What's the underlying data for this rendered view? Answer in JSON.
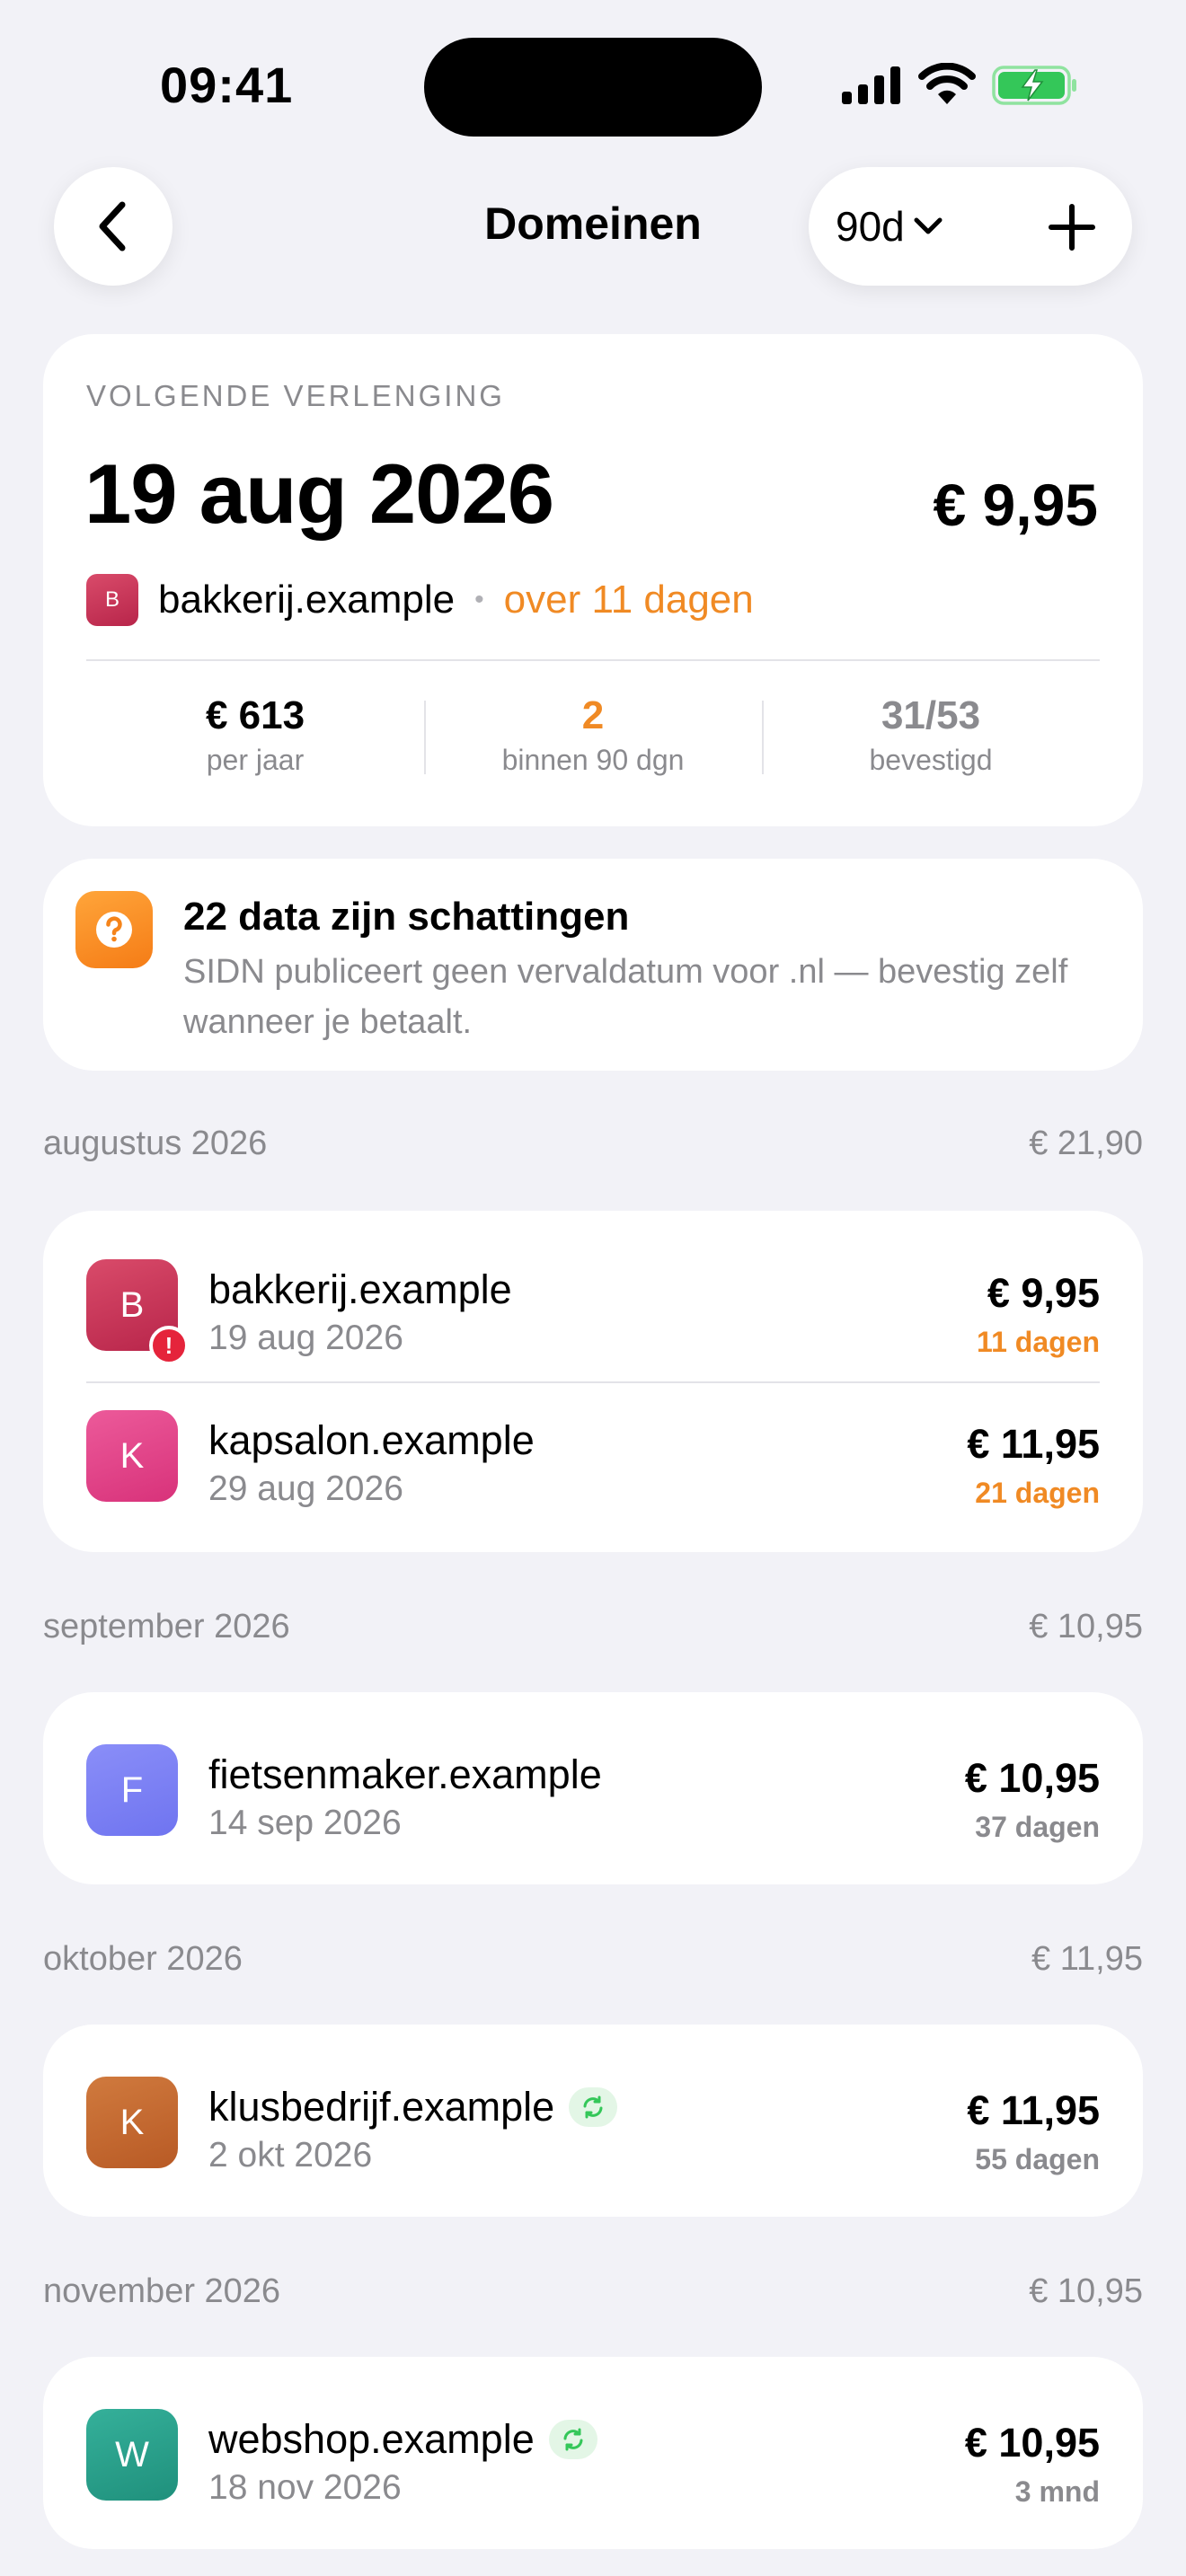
{
  "status_bar": {
    "time": "09:41"
  },
  "nav": {
    "title": "Domeinen",
    "range": "90d"
  },
  "hero": {
    "label": "VOLGENDE VERLENGING",
    "date": "19 aug 2026",
    "price": "€ 9,95",
    "avatar_letter": "B",
    "domain": "bakkerij.example",
    "due": "over 11 dagen",
    "stats": [
      {
        "value": "€ 613",
        "label": "per jaar"
      },
      {
        "value": "2",
        "label": "binnen 90 dgn"
      },
      {
        "value": "31/53",
        "label": "bevestigd"
      }
    ]
  },
  "notice": {
    "title": "22 data zijn schattingen",
    "text": "SIDN publiceert geen vervaldatum voor .nl — bevestig zelf wanneer je betaalt."
  },
  "sections": [
    {
      "month": "augustus 2026",
      "total": "€ 21,90",
      "items": [
        {
          "letter": "B",
          "name": "bakkerij.example",
          "date": "19 aug 2026",
          "price": "€ 9,95",
          "remaining": "11 dagen"
        },
        {
          "letter": "K",
          "name": "kapsalon.example",
          "date": "29 aug 2026",
          "price": "€ 11,95",
          "remaining": "21 dagen"
        }
      ]
    },
    {
      "month": "september 2026",
      "total": "€ 10,95",
      "items": [
        {
          "letter": "F",
          "name": "fietsenmaker.example",
          "date": "14 sep 2026",
          "price": "€ 10,95",
          "remaining": "37 dagen"
        }
      ]
    },
    {
      "month": "oktober 2026",
      "total": "€ 11,95",
      "items": [
        {
          "letter": "K",
          "name": "klusbedrijf.example",
          "date": "2 okt 2026",
          "price": "€ 11,95",
          "remaining": "55 dagen"
        }
      ]
    },
    {
      "month": "november 2026",
      "total": "€ 10,95",
      "items": [
        {
          "letter": "W",
          "name": "webshop.example",
          "date": "18 nov 2026",
          "price": "€ 10,95",
          "remaining": "3 mnd"
        }
      ]
    }
  ],
  "colors": {
    "warning": "#f08a24",
    "alert": "#e5243b",
    "renew": "#34c759"
  }
}
